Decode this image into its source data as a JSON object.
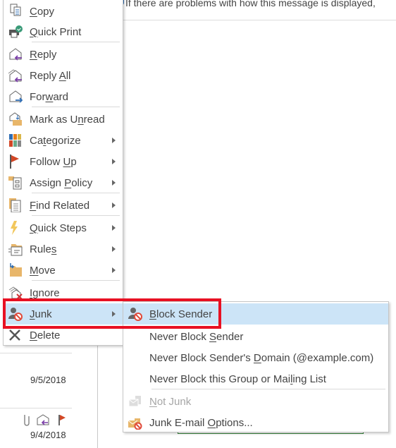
{
  "infobar": {
    "text": "If there are problems with how this message is displayed,"
  },
  "message_list": {
    "dates": [
      "9/5/2018",
      "9/4/2018"
    ],
    "row_icons": [
      "paperclip-icon",
      "reply-icon",
      "flag-icon"
    ]
  },
  "context_menu": {
    "items": [
      {
        "label": "Copy",
        "accel": 0,
        "icon": "copy-icon"
      },
      {
        "label": "Quick Print",
        "accel": 0,
        "icon": "quick-print-icon"
      },
      {
        "label": "Reply",
        "accel": 0,
        "icon": "reply-icon"
      },
      {
        "label": "Reply All",
        "accel": 6,
        "icon": "reply-all-icon"
      },
      {
        "label": "Forward",
        "accel": 3,
        "icon": "forward-icon"
      },
      {
        "label": "Mark as Unread",
        "accel": 9,
        "icon": "mark-unread-icon"
      },
      {
        "label": "Categorize",
        "accel": 2,
        "icon": "categorize-icon",
        "submenu": true
      },
      {
        "label": "Follow Up",
        "accel": 7,
        "icon": "flag-icon",
        "submenu": true
      },
      {
        "label": "Assign Policy",
        "accel": 7,
        "icon": "assign-policy-icon",
        "submenu": true
      },
      {
        "label": "Find Related",
        "accel": 0,
        "icon": "find-related-icon",
        "submenu": true
      },
      {
        "label": "Quick Steps",
        "accel": 0,
        "icon": "quick-steps-icon",
        "submenu": true
      },
      {
        "label": "Rules",
        "accel": 4,
        "icon": "rules-icon",
        "submenu": true
      },
      {
        "label": "Move",
        "accel": 0,
        "icon": "move-icon",
        "submenu": true
      },
      {
        "label": "Ignore",
        "accel": 0,
        "icon": "ignore-icon"
      },
      {
        "label": "Junk",
        "accel": 0,
        "icon": "junk-icon",
        "submenu": true,
        "highlighted": true
      },
      {
        "label": "Delete",
        "accel": 0,
        "icon": "delete-icon"
      }
    ]
  },
  "junk_submenu": {
    "items": [
      {
        "label": "Block Sender",
        "accel": 0,
        "icon": "block-sender-icon",
        "highlighted": true
      },
      {
        "label": "Never Block Sender",
        "accel": 12
      },
      {
        "label": "Never Block Sender's Domain (@example.com)",
        "accel": 21
      },
      {
        "label": "Never Block this Group or Mailing List",
        "accel": 29
      },
      {
        "label": "Not Junk",
        "accel": 0,
        "icon": "not-junk-icon",
        "disabled": true
      },
      {
        "label": "Junk E-mail Options...",
        "accel": 12,
        "icon": "junk-options-icon"
      }
    ]
  },
  "colors": {
    "highlight": "#cce4f7",
    "annotation": "#e81123"
  }
}
